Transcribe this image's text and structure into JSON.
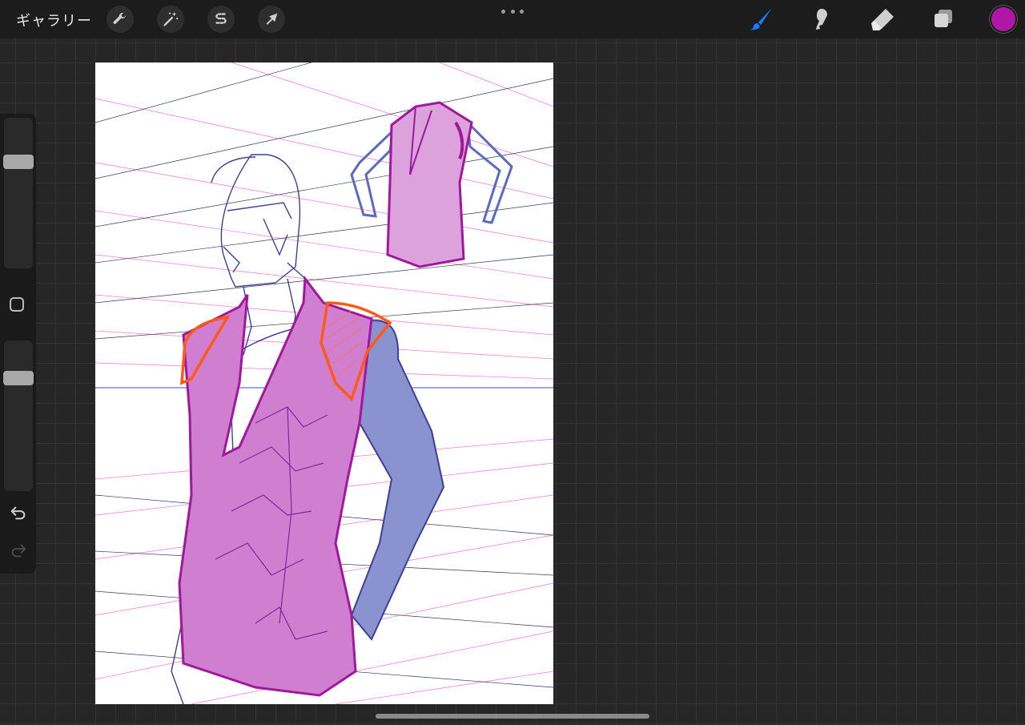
{
  "topbar": {
    "gallery_label": "ギャラリー",
    "left_tools": [
      {
        "icon": "wrench-icon",
        "name": "actions"
      },
      {
        "icon": "magic-wand-icon",
        "name": "adjustments"
      },
      {
        "icon": "selection-s-icon",
        "name": "selection"
      },
      {
        "icon": "arrow-cursor-icon",
        "name": "transform"
      }
    ],
    "more_icon": "ellipsis-icon",
    "right_tools": [
      {
        "icon": "brush-icon",
        "name": "paint",
        "active": true
      },
      {
        "icon": "smudge-icon",
        "name": "smudge",
        "active": false
      },
      {
        "icon": "eraser-icon",
        "name": "erase",
        "active": false
      },
      {
        "icon": "layers-icon",
        "name": "layers",
        "active": false
      }
    ],
    "current_color": "#b016a8",
    "active_tool_color": "#1a7cff"
  },
  "sidebar": {
    "brush_size_level": 0.7,
    "opacity_level": 0.75,
    "modifier_icon": "square-icon",
    "undo_icon": "undo-icon",
    "redo_icon": "redo-icon"
  },
  "canvas": {
    "background": "#ffffff",
    "artwork": "figure-in-vest-sketch",
    "colors": {
      "vest": "#c24fc0",
      "vest_outline": "#9a1497",
      "sleeve": "#4a5ab0",
      "line": "#3b3f99",
      "shoulder_accent": "#ff5a14",
      "perspective_pink": "#ff6fd0",
      "horizon": "#3b4bd8"
    }
  }
}
